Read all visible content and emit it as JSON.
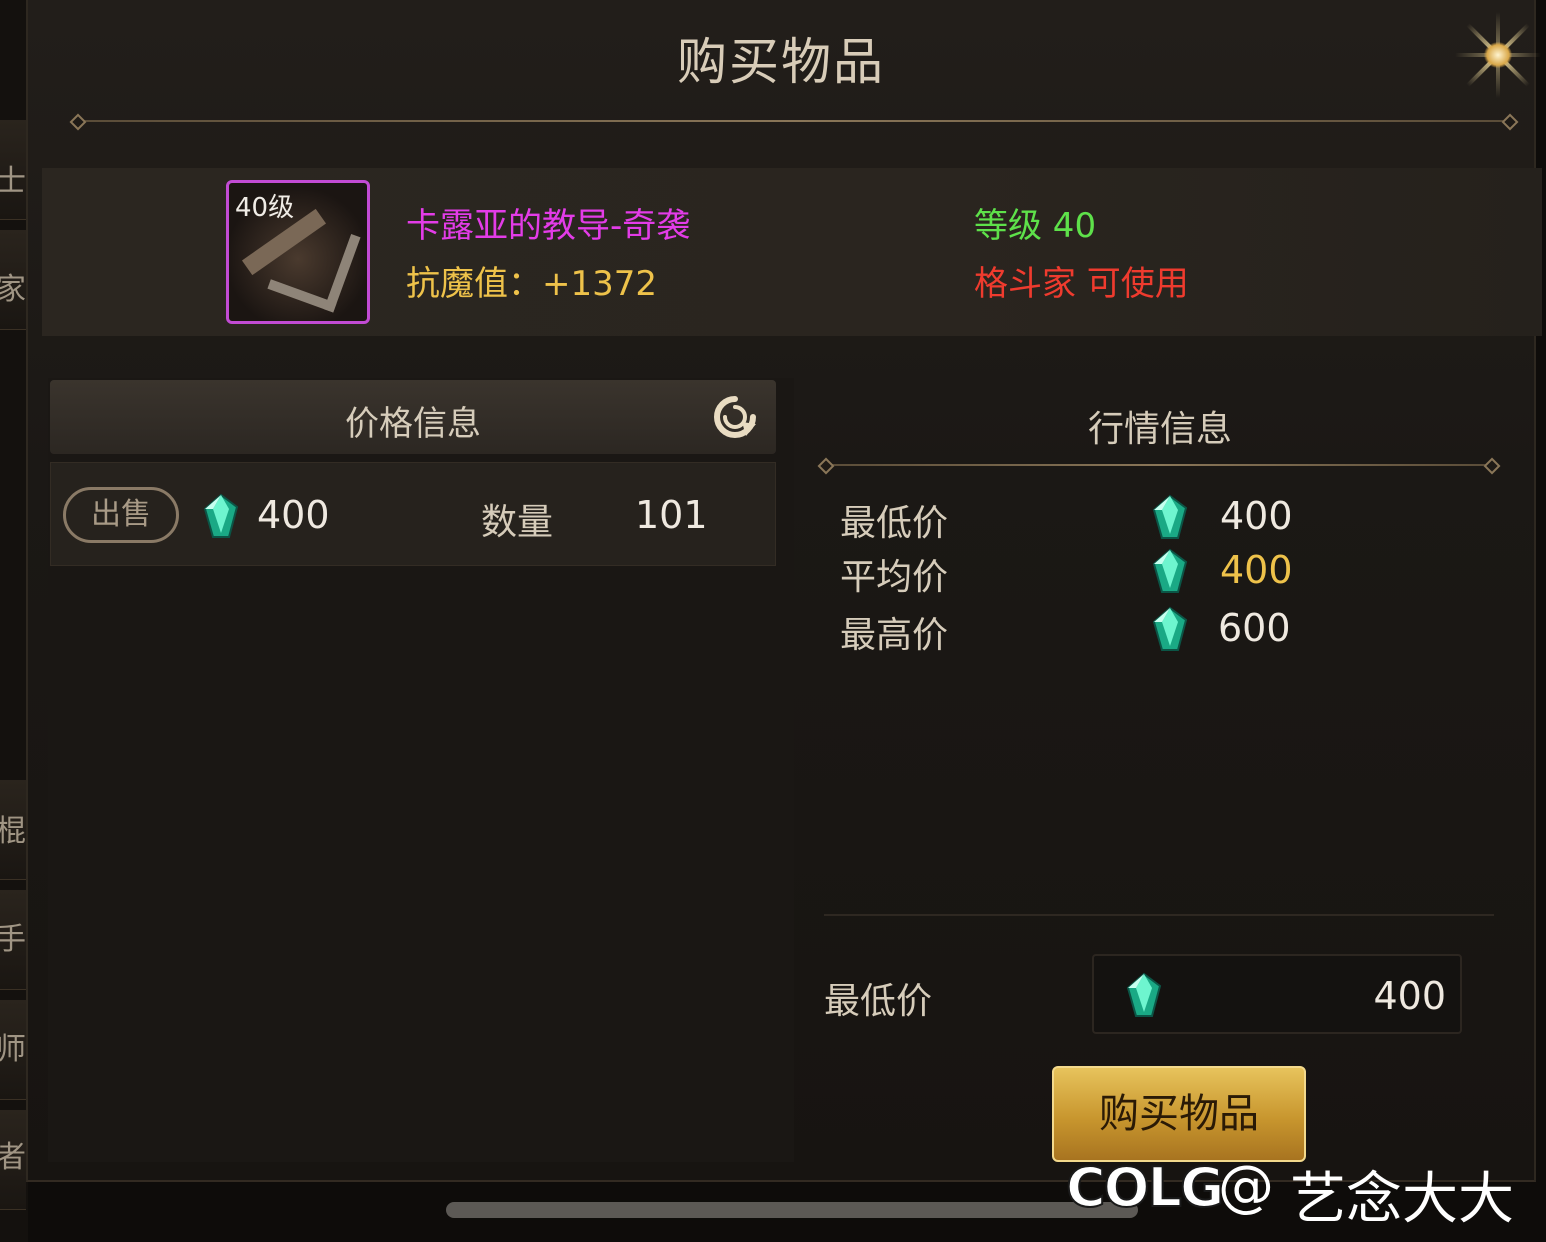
{
  "window": {
    "title": "购买物品"
  },
  "side_tabs": [
    "士",
    "家",
    "棍",
    "手",
    "师",
    "者"
  ],
  "item": {
    "level_badge": "40级",
    "name": "卡露亚的教导-奇袭",
    "stat": "抗魔值：+1372",
    "level_text": "等级 40",
    "usable_text": "格斗家 可使用",
    "icon": "bow-icon"
  },
  "price_info": {
    "header": "价格信息",
    "refresh_icon": "refresh-icon",
    "listing": {
      "badge": "出售",
      "price": "400",
      "qty_label": "数量",
      "qty": "101"
    }
  },
  "market_info": {
    "title": "行情信息",
    "rows": [
      {
        "label": "最低价",
        "value": "400"
      },
      {
        "label": "平均价",
        "value": "400"
      },
      {
        "label": "最高价",
        "value": "600"
      }
    ]
  },
  "purchase": {
    "label": "最低价",
    "value": "400",
    "button": "购买物品"
  },
  "watermark": {
    "logo": "COLG",
    "at": "@",
    "name": "艺念大大"
  },
  "colors": {
    "item_name": "#e33ce8",
    "stat": "#eec24a",
    "level": "#5ee14a",
    "usable": "#ef3b2e",
    "avg_price": "#eec24a",
    "gem": "#2fd6a8"
  }
}
